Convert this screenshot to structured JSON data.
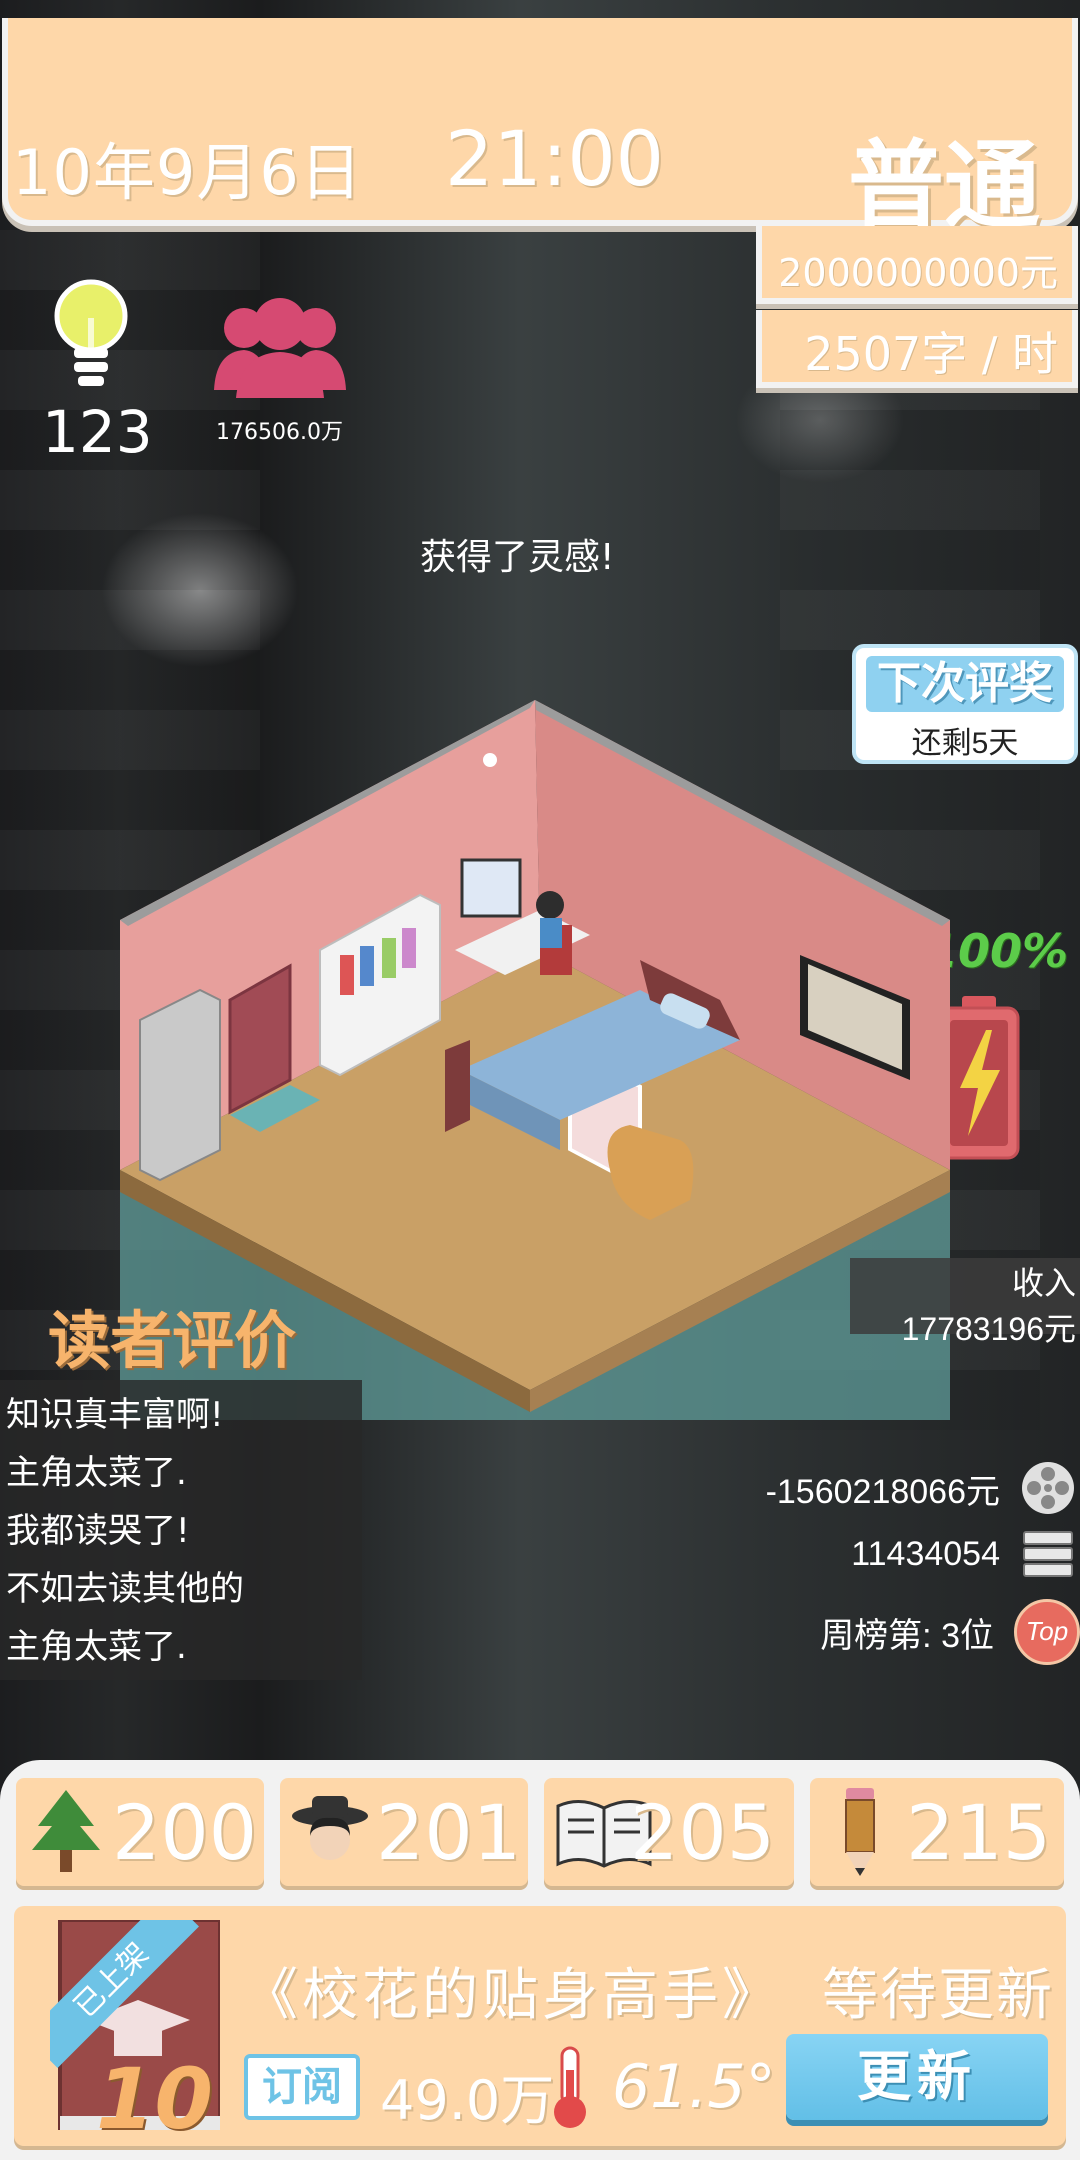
{
  "header": {
    "date": "10年9月6日",
    "time": "21:00",
    "difficulty": "普通",
    "money": "2000000000元",
    "writing_speed": "2507字 / 时"
  },
  "stats": {
    "inspiration": "123",
    "fans": "176506.0万"
  },
  "message": "获得了灵感!",
  "award": {
    "title": "下次评奖",
    "remaining": "还剩5天"
  },
  "battery": {
    "percent": "100%",
    "level": 1.0
  },
  "income": {
    "label": "收入",
    "value": "17783196元"
  },
  "reviews": {
    "title": "读者评价",
    "items": [
      "知识真丰富啊!",
      "主角太菜了.",
      "我都读哭了!",
      "不如去读其他的",
      "主角太菜了."
    ]
  },
  "right_stats": {
    "expense": "-1560218066元",
    "words": "11434054",
    "rank": "周榜第: 3位",
    "rank_badge": "Top"
  },
  "attributes": [
    {
      "icon": "tree-icon",
      "value": "200"
    },
    {
      "icon": "character-hat-icon",
      "value": "201"
    },
    {
      "icon": "open-book-icon",
      "value": "205"
    },
    {
      "icon": "pencil-icon",
      "value": "215"
    }
  ],
  "book": {
    "status_ribbon": "已上架",
    "level": "10",
    "title": "《校花的贴身高手》",
    "status": "等待更新",
    "subscribe_label": "订阅",
    "subscriptions": "49.0万",
    "heat": "61.5°",
    "update_label": "更新"
  },
  "colors": {
    "panel": "#fed7a9",
    "accent_blue": "#6ec3e6",
    "review_title": "#f7b46c",
    "battery_green": "#5ccc4a"
  }
}
